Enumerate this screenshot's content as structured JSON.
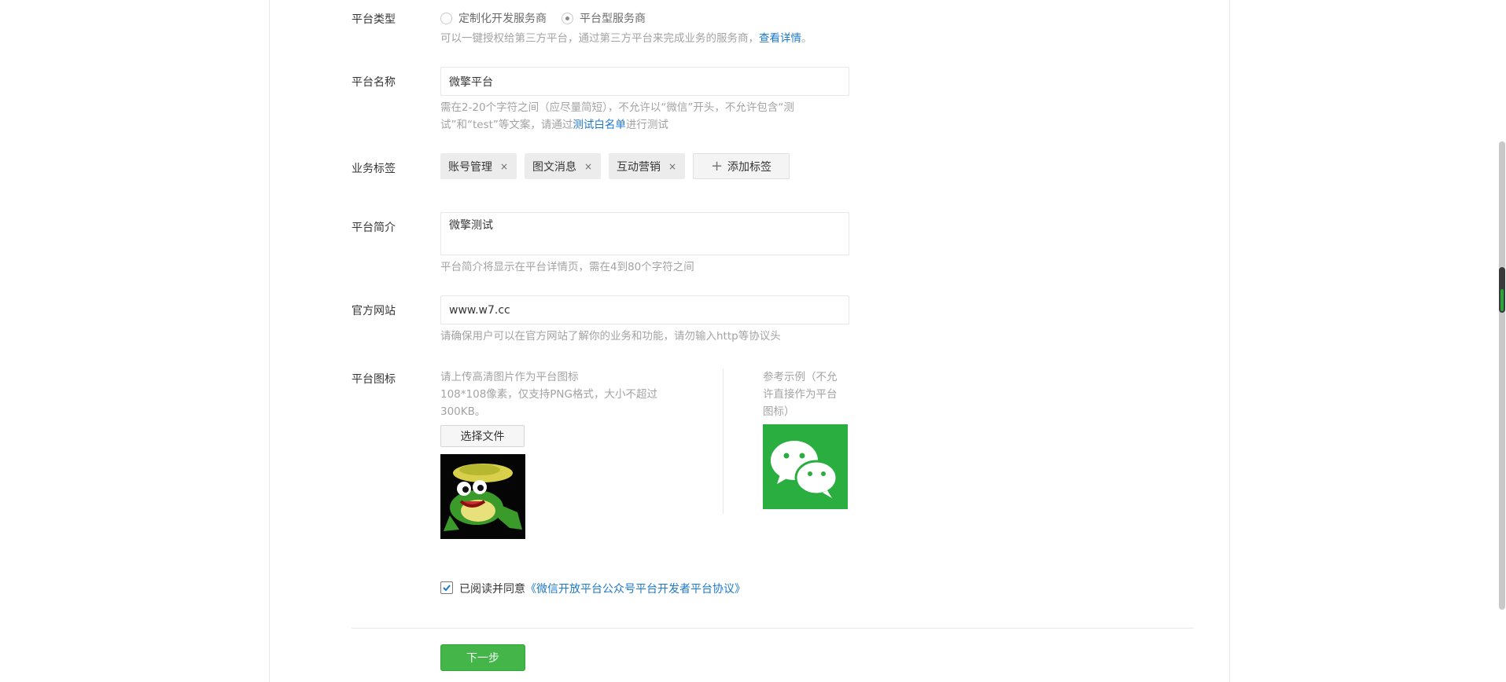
{
  "platform_type": {
    "label": "平台类型",
    "options": [
      "定制化开发服务商",
      "平台型服务商"
    ],
    "selected_index": 1,
    "hint_prefix": "可以一键授权给第三方平台，通过第三方平台来完成业务的服务商，",
    "hint_link": "查看详情",
    "hint_suffix": "。"
  },
  "platform_name": {
    "label": "平台名称",
    "value": "微擎平台",
    "hint_line1": "需在2-20个字符之间（应尽量简短），不允许以“微信”开头，不允许包含“测",
    "hint_line2_prefix": "试”和“test”等文案，请通过",
    "hint_link": "测试白名单",
    "hint_line2_suffix": "进行测试"
  },
  "business_tags": {
    "label": "业务标签",
    "tags": [
      "账号管理",
      "图文消息",
      "互动营销"
    ],
    "remove_symbol": "×",
    "add_label": "添加标签"
  },
  "platform_intro": {
    "label": "平台简介",
    "value": "微擎测试",
    "hint": "平台简介将显示在平台详情页，需在4到80个字符之间"
  },
  "official_site": {
    "label": "官方网站",
    "value": "www.w7.cc",
    "hint": "请确保用户可以在官方网站了解你的业务和功能，请勿输入http等协议头"
  },
  "platform_icon": {
    "label": "平台图标",
    "hint_line1": "请上传高清图片作为平台图标",
    "hint_line2": "108*108像素，仅支持PNG格式，大小不超过",
    "hint_line3": "300KB。",
    "choose_file": "选择文件",
    "example_line1": "参考示例（不允",
    "example_line2": "许直接作为平台",
    "example_line3": "图标）"
  },
  "agreement": {
    "checked": true,
    "prefix": "已阅读并同意",
    "link": "《微信开放平台公众号平台开发者平台协议》"
  },
  "next_button": "下一步",
  "colors": {
    "primary_green": "#44b549",
    "link_blue": "#1e78c8",
    "hint_gray": "#a3a3a3",
    "wechat_green": "#2aae40"
  }
}
